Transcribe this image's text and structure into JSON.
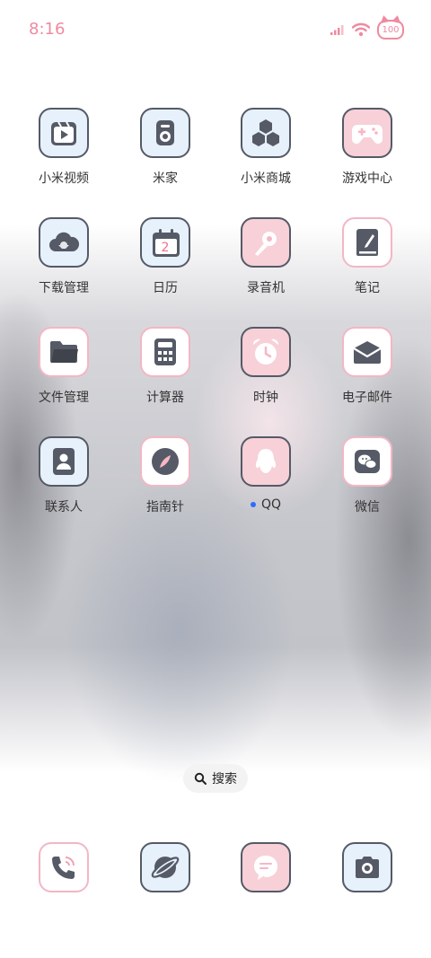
{
  "status": {
    "time": "8:16",
    "battery": "100"
  },
  "colors": {
    "accent_pink": "#ef8aa0",
    "icon_dark": "#555a66",
    "icon_blue_bg": "#e6f1fb",
    "icon_pink_bg": "#f7d0d8",
    "badge_blue": "#2f6bff"
  },
  "apps": [
    {
      "label": "小米视频",
      "icon": "video-player-icon"
    },
    {
      "label": "米家",
      "icon": "speaker-icon"
    },
    {
      "label": "小米商城",
      "icon": "hexagons-icon"
    },
    {
      "label": "游戏中心",
      "icon": "gamepad-icon"
    },
    {
      "label": "下载管理",
      "icon": "cloud-icon"
    },
    {
      "label": "日历",
      "icon": "calendar-icon",
      "badge_text": "2"
    },
    {
      "label": "录音机",
      "icon": "microphone-icon"
    },
    {
      "label": "笔记",
      "icon": "notebook-icon"
    },
    {
      "label": "文件管理",
      "icon": "folder-icon"
    },
    {
      "label": "计算器",
      "icon": "calculator-icon"
    },
    {
      "label": "时钟",
      "icon": "alarm-clock-icon"
    },
    {
      "label": "电子邮件",
      "icon": "envelope-icon"
    },
    {
      "label": "联系人",
      "icon": "contact-card-icon"
    },
    {
      "label": "指南针",
      "icon": "compass-icon"
    },
    {
      "label": "QQ",
      "icon": "penguin-icon",
      "new_dot": true
    },
    {
      "label": "微信",
      "icon": "wechat-icon"
    }
  ],
  "search": {
    "label": "搜索"
  },
  "dock": [
    {
      "name": "phone",
      "icon": "phone-icon"
    },
    {
      "name": "browser",
      "icon": "planet-icon"
    },
    {
      "name": "messages",
      "icon": "message-bubble-icon"
    },
    {
      "name": "camera",
      "icon": "camera-icon"
    }
  ]
}
